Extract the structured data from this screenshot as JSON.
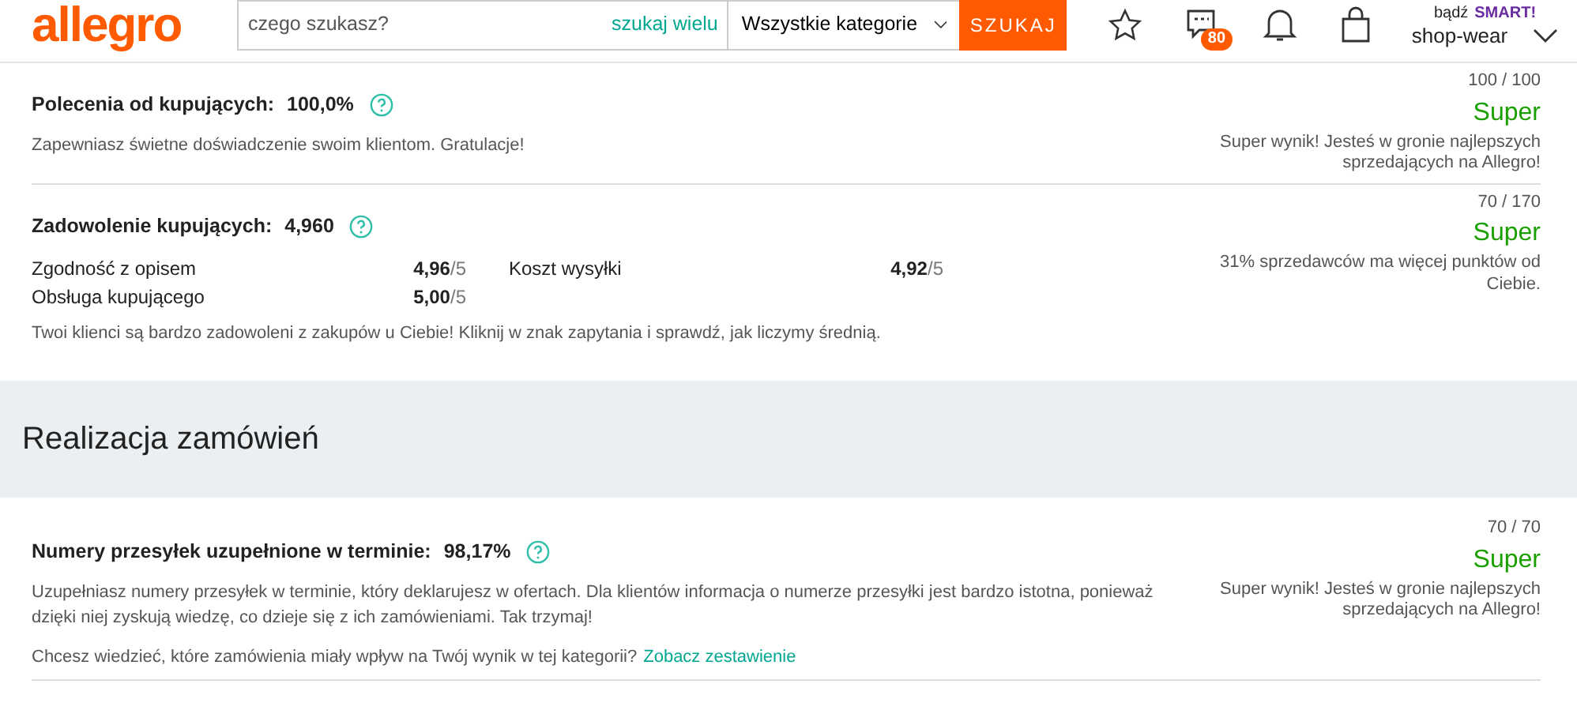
{
  "header": {
    "logo": "allegro",
    "search": {
      "placeholder": "czego szukasz?",
      "multi_link": "szukaj wielu",
      "category": "Wszystkie kategorie",
      "button": "SZUKAJ"
    },
    "messages_badge": "80",
    "smart_prefix": "bądź",
    "smart_brand": "SMART!",
    "account": "shop-wear"
  },
  "sections": [
    {
      "metrics": [
        {
          "label": "Polecenia od kupujących:",
          "value": "100,0%",
          "note": "Zapewniasz świetne doświadczenie swoim klientom. Gratulacje!",
          "score": "100 / 100",
          "rating": "Super",
          "rating_note": "Super wynik! Jesteś w gronie najlepszych sprzedających na Allegro!"
        },
        {
          "label": "Zadowolenie kupujących:",
          "value": "4,960",
          "subscores": [
            {
              "name": "Zgodność z opisem",
              "value": "4,96",
              "max": "/5"
            },
            {
              "name": "Koszt wysyłki",
              "value": "4,92",
              "max": "/5"
            },
            {
              "name": "Obsługa kupującego",
              "value": "5,00",
              "max": "/5"
            }
          ],
          "note": "Twoi klienci są bardzo zadowoleni z zakupów u Ciebie! Kliknij w znak zapytania i sprawdź, jak liczymy średnią.",
          "score": "70 / 170",
          "rating": "Super",
          "rating_note": "31% sprzedawców ma więcej punktów od Ciebie."
        }
      ]
    },
    {
      "heading": "Realizacja zamówień",
      "metrics": [
        {
          "label": "Numery przesyłek uzupełnione w terminie:",
          "value": "98,17%",
          "note": "Uzupełniasz numery przesyłek w terminie, który deklarujesz w ofertach. Dla klientów informacja o numerze przesyłki jest bardzo istotna, ponieważ dzięki niej zyskują wiedzę, co dzieje się z ich zamówieniami. Tak trzymaj!",
          "question": "Chcesz wiedzieć, które zamówienia miały wpływ na Twój wynik w tej kategorii?",
          "link": "Zobacz zestawienie",
          "score": "70 / 70",
          "rating": "Super",
          "rating_note": "Super wynik! Jesteś w gronie najlepszych sprzedających na Allegro!"
        }
      ]
    }
  ]
}
